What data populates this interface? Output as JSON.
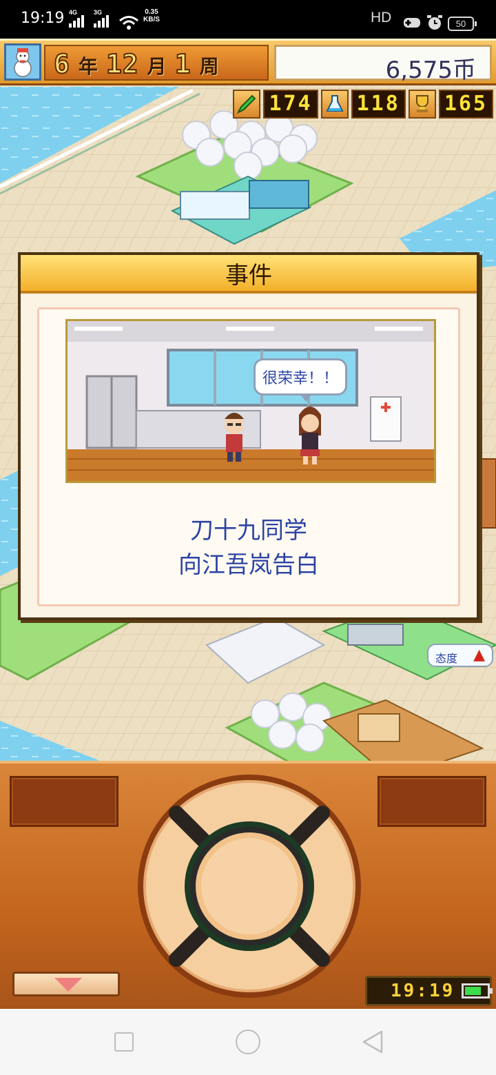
{
  "status_bar": {
    "time": "19:19",
    "sim1_tag": "4G",
    "sim2_tag": "3G",
    "net_speed_value": "0.35",
    "net_speed_unit": "KB/S",
    "hd_label": "HD",
    "battery": "50"
  },
  "header": {
    "year": "6",
    "year_unit": "年",
    "month": "12",
    "month_unit": "月",
    "week": "1",
    "week_unit": "周",
    "money": "6,575币",
    "season_icon": "snowman-icon"
  },
  "stats": [
    {
      "icon": "pencil-icon",
      "value": "174"
    },
    {
      "icon": "flask-icon",
      "value": "118"
    },
    {
      "icon": "trophy-icon",
      "value": "165"
    }
  ],
  "dialog": {
    "title": "事件",
    "speech": "很荣幸！！",
    "line1": "刀十九同学",
    "line2": "向江吾岚告白"
  },
  "attitude": {
    "label": "态度",
    "indicator": "上升"
  },
  "controller": {
    "clock": "19:19"
  },
  "colors": {
    "panel_orange": "#c4661e",
    "dialog_header": "#f3b02a",
    "text_blue": "#2c43a4"
  }
}
